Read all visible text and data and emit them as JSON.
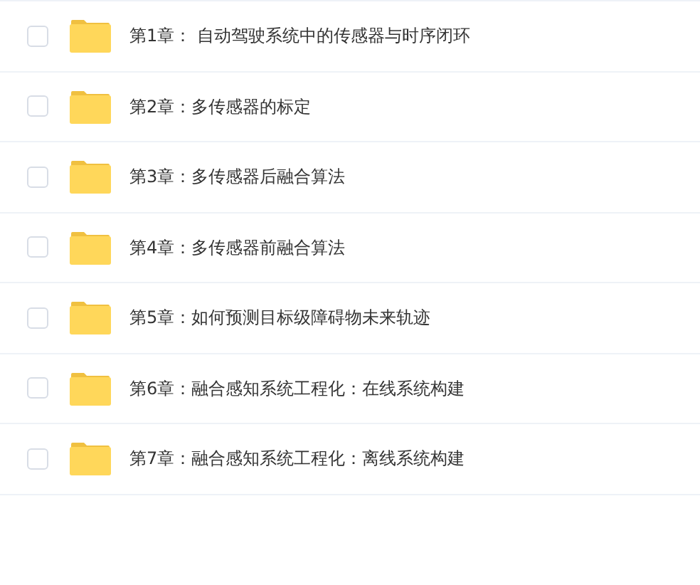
{
  "items": [
    {
      "label": "第1章： 自动驾驶系统中的传感器与时序闭环",
      "checked": false
    },
    {
      "label": "第2章：多传感器的标定",
      "checked": false
    },
    {
      "label": "第3章：多传感器后融合算法",
      "checked": false
    },
    {
      "label": "第4章：多传感器前融合算法",
      "checked": false
    },
    {
      "label": "第5章：如何预测目标级障碍物未来轨迹",
      "checked": false
    },
    {
      "label": "第6章：融合感知系统工程化：在线系统构建",
      "checked": false
    },
    {
      "label": "第7章：融合感知系统工程化：离线系统构建",
      "checked": false
    }
  ]
}
